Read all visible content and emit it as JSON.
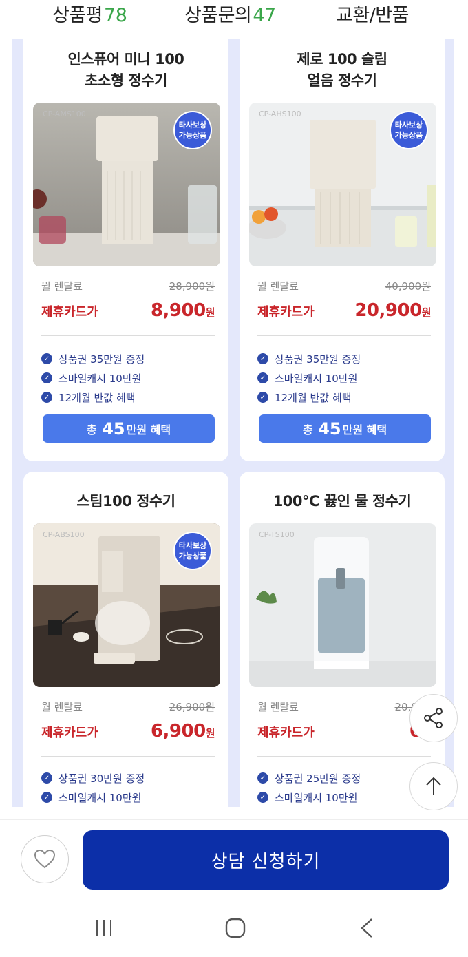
{
  "tabs": {
    "reviews_label": "상품평",
    "reviews_count": "78",
    "inquiry_label": "상품문의",
    "inquiry_count": "47",
    "return_label": "교환/반품"
  },
  "products": [
    {
      "title_line1": "인스퓨어 미니 100",
      "title_line2": "초소형 정수기",
      "model": "CP-AMS100",
      "badge_line1": "타사보상",
      "badge_line2": "가능상품",
      "monthly_label": "월 렌탈료",
      "monthly_original": "28,900원",
      "card_label": "제휴카드가",
      "card_price": "8,900",
      "won": "원",
      "benefits": [
        "상품권 35만원 증정",
        "스마일캐시 10만원",
        "12개월 반값 혜택"
      ],
      "total_prefix": "총",
      "total_amount": "45",
      "total_suffix": "만원 혜택"
    },
    {
      "title_line1": "제로 100 슬림",
      "title_line2": "얼음 정수기",
      "model": "CP-AHS100",
      "badge_line1": "타사보상",
      "badge_line2": "가능상품",
      "monthly_label": "월 렌탈료",
      "monthly_original": "40,900원",
      "card_label": "제휴카드가",
      "card_price": "20,900",
      "won": "원",
      "benefits": [
        "상품권 35만원 증정",
        "스마일캐시 10만원",
        "12개월 반값 혜택"
      ],
      "total_prefix": "총",
      "total_amount": "45",
      "total_suffix": "만원 혜택"
    },
    {
      "title_line1": "스팀100 정수기",
      "model": "CP-ABS100",
      "badge_line1": "타사보상",
      "badge_line2": "가능상품",
      "monthly_label": "월 렌탈료",
      "monthly_original": "26,900원",
      "card_label": "제휴카드가",
      "card_price": "6,900",
      "won": "원",
      "benefits": [
        "상품권 30만원 증정",
        "스마일캐시 10만원"
      ]
    },
    {
      "title_line1": "100°C 끓인 물 정수기",
      "model": "CP-TS100",
      "monthly_label": "월 렌탈료",
      "monthly_original": "20,900",
      "card_label": "제휴카드가",
      "card_price": "0",
      "won": "원",
      "benefits": [
        "상품권 25만원 증정",
        "스마일캐시 10만원"
      ]
    }
  ],
  "floating": {
    "share_icon": "share-icon",
    "top_icon": "arrow-up-icon"
  },
  "bottom": {
    "like_icon": "heart-icon",
    "consult_label": "상담 신청하기"
  },
  "system_nav": {
    "recent_icon": "recent-apps-icon",
    "home_icon": "home-icon",
    "back_icon": "back-icon"
  },
  "colors": {
    "accent": "#0c2fa8",
    "benefit_button": "#4a79ea",
    "price_red": "#c9262b",
    "count_green": "#3aa64a",
    "panel_bg": "#e4e8fb"
  }
}
